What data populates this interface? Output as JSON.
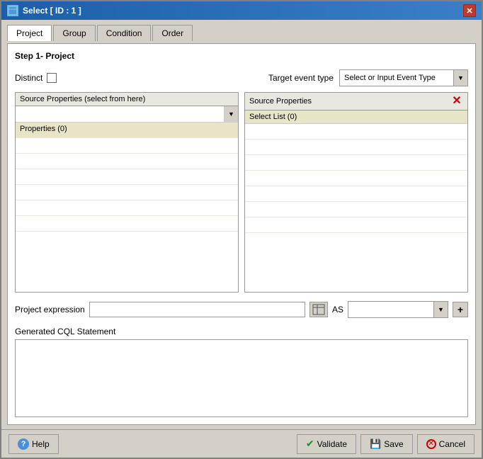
{
  "window": {
    "title": "Select [ ID : 1 ]",
    "icon_label": "S",
    "close_label": "✕"
  },
  "tabs": [
    {
      "id": "project",
      "label": "Project",
      "active": true
    },
    {
      "id": "group",
      "label": "Group",
      "active": false
    },
    {
      "id": "condition",
      "label": "Condition",
      "active": false
    },
    {
      "id": "order",
      "label": "Order",
      "active": false
    }
  ],
  "step_title": "Step 1- Project",
  "distinct_label": "Distinct",
  "target_event_label": "Target event type",
  "target_event_placeholder": "Select or Input Event Type",
  "source_props_left_header": "Source Properties (select from here)",
  "source_props_left_dropdown_placeholder": "",
  "source_props_left_item": "Properties (0)",
  "source_props_right_header": "Source Properties",
  "select_list_label": "Select List (0)",
  "project_expression_label": "Project expression",
  "expr_btn_label": "⊞",
  "as_label": "AS",
  "plus_btn_label": "+",
  "cql_label": "Generated CQL Statement",
  "footer": {
    "help_label": "Help",
    "validate_label": "Validate",
    "save_label": "Save",
    "cancel_label": "Cancel"
  },
  "colors": {
    "title_bar_start": "#1a5fa8",
    "title_bar_end": "#3a7fc8",
    "selected_row": "#e8e4c8",
    "delete_color": "#cc0000",
    "validate_color": "#228B22",
    "cancel_color": "#cc0000"
  }
}
